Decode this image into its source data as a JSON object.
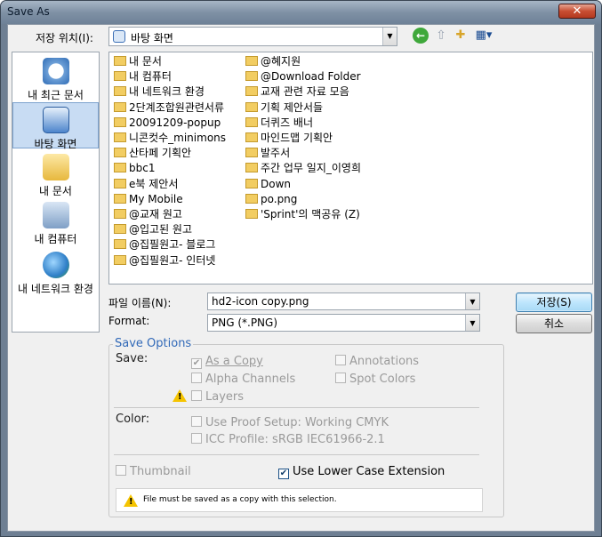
{
  "window": {
    "title": "Save As",
    "close_glyph": "✕"
  },
  "toolbar": {
    "look_in_label": "저장 위치(I):",
    "look_in_value": "바탕 화면",
    "back_icon": "back-arrow-icon",
    "up_icon": "up-folder-icon",
    "new_folder_icon": "new-folder-icon",
    "views_icon": "views-menu-icon"
  },
  "places": [
    {
      "label": "내 최근 문서",
      "icon": "recent-documents-icon"
    },
    {
      "label": "바탕 화면",
      "icon": "desktop-icon",
      "selected": true
    },
    {
      "label": "내 문서",
      "icon": "my-documents-icon"
    },
    {
      "label": "내 컴퓨터",
      "icon": "my-computer-icon"
    },
    {
      "label": "내 네트워크 환경",
      "icon": "network-icon"
    }
  ],
  "files_col1": [
    "내 문서",
    "내 컴퓨터",
    "내 네트워크 환경",
    "2단계조합원관련서류",
    "20091209-popup",
    "니콘컷수_minimons",
    "산타페 기획안",
    "bbc1",
    "e북 제안서",
    "My Mobile",
    "@교재 원고",
    "@입고된 원고",
    "@집필원고- 블로그",
    "@집필원고- 인터넷"
  ],
  "files_col2": [
    "@혜지원",
    "@Download Folder",
    "교재 관련 자료 모음",
    "기획 제안서들",
    "더퀴즈 배너",
    "마인드맵 기획안",
    "발주서",
    "주간 업무 일지_이영희",
    "Down",
    "po.png",
    "'Sprint'의 맥공유 (Z)"
  ],
  "file_name": {
    "label": "파일 이름(N):",
    "value": "hd2-icon copy.png"
  },
  "format": {
    "label": "Format:",
    "value": "PNG (*.PNG)"
  },
  "buttons": {
    "save": "저장(S)",
    "cancel": "취소"
  },
  "save_options": {
    "title": "Save Options",
    "save_label": "Save:",
    "as_a_copy": "As a Copy",
    "annotations": "Annotations",
    "alpha_channels": "Alpha Channels",
    "spot_colors": "Spot Colors",
    "layers": "Layers",
    "color_label": "Color:",
    "use_proof_setup": "Use Proof Setup:  Working CMYK",
    "icc_profile": "ICC Profile:  sRGB IEC61966-2.1",
    "thumbnail": "Thumbnail",
    "lower_case": "Use Lower Case Extension",
    "warning": "File must be saved as a copy with this selection."
  }
}
